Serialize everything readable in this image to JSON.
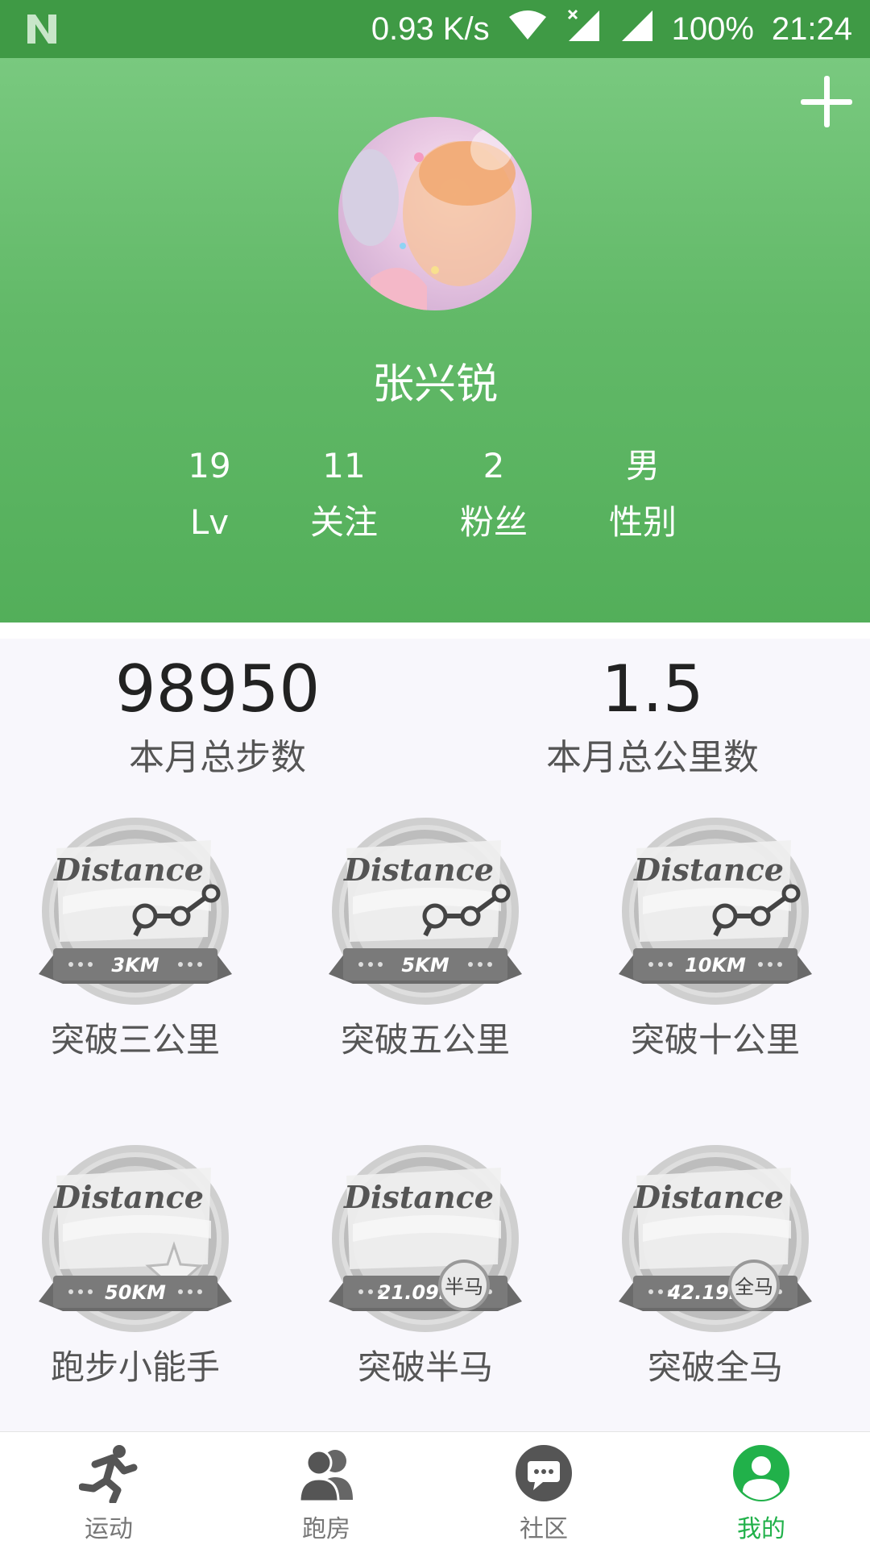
{
  "status_bar": {
    "speed": "0.93 K/s",
    "battery": "100%",
    "time": "21:24",
    "icons": [
      "notification-n-icon",
      "wifi-icon",
      "signal-off-icon",
      "signal-icon"
    ]
  },
  "profile": {
    "name": "张兴锐",
    "stats": [
      {
        "value": "19",
        "label": "Lv"
      },
      {
        "value": "11",
        "label": "关注"
      },
      {
        "value": "2",
        "label": "粉丝"
      },
      {
        "value": "男",
        "label": "性别"
      }
    ]
  },
  "totals": {
    "steps_value": "98950",
    "steps_label": "本月总步数",
    "km_value": "1.5",
    "km_label": "本月总公里数"
  },
  "badges": [
    {
      "title": "Distance",
      "distance": "3KM",
      "label": "突破三公里"
    },
    {
      "title": "Distance",
      "distance": "5KM",
      "label": "突破五公里"
    },
    {
      "title": "Distance",
      "distance": "10KM",
      "label": "突破十公里"
    },
    {
      "title": "Distance",
      "distance": "50KM",
      "label": "跑步小能手"
    },
    {
      "title": "Distance",
      "distance": "21.09KM",
      "tag": "半马",
      "label": "突破半马"
    },
    {
      "title": "Distance",
      "distance": "42.19KM",
      "tag": "全马",
      "label": "突破全马"
    }
  ],
  "nav": [
    {
      "label": "运动",
      "icon": "running-man-icon"
    },
    {
      "label": "跑房",
      "icon": "people-icon"
    },
    {
      "label": "社区",
      "icon": "chat-bubble-icon"
    },
    {
      "label": "我的",
      "icon": "profile-icon",
      "active": true
    }
  ],
  "colors": {
    "header": "#5bb662",
    "status_bar": "#3f9a45",
    "active": "#21b14a"
  }
}
